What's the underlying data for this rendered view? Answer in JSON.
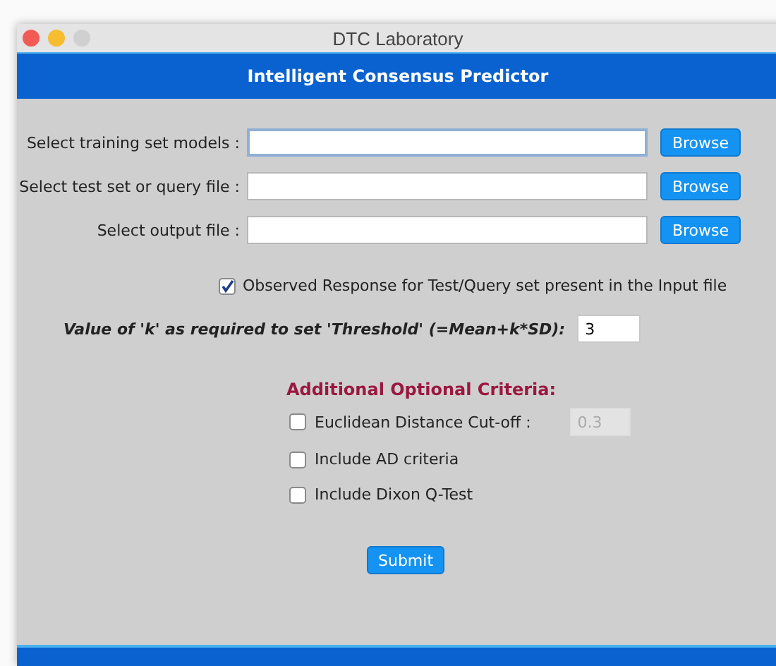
{
  "window": {
    "title": "DTC Laboratory"
  },
  "header": {
    "title": "Intelligent Consensus Predictor"
  },
  "file_rows": [
    {
      "label": "Select training set models :",
      "button": "Browse",
      "focused": true
    },
    {
      "label": "Select test set or query file :",
      "button": "Browse",
      "focused": false
    },
    {
      "label": "Select output file :",
      "button": "Browse",
      "focused": false
    }
  ],
  "observed_response": {
    "label": "Observed Response for Test/Query set present in the Input file",
    "checked": true
  },
  "k_value": {
    "label": "Value of 'k' as required to set 'Threshold' (=Mean+k*SD):",
    "value": "3"
  },
  "optional": {
    "title": "Additional Optional Criteria:",
    "items": [
      {
        "label": "Euclidean Distance Cut-off :",
        "checked": false,
        "field": {
          "value": "0.3",
          "disabled": true
        }
      },
      {
        "label": "Include AD criteria",
        "checked": false
      },
      {
        "label": "Include Dixon Q-Test",
        "checked": false
      }
    ]
  },
  "submit": "Submit"
}
